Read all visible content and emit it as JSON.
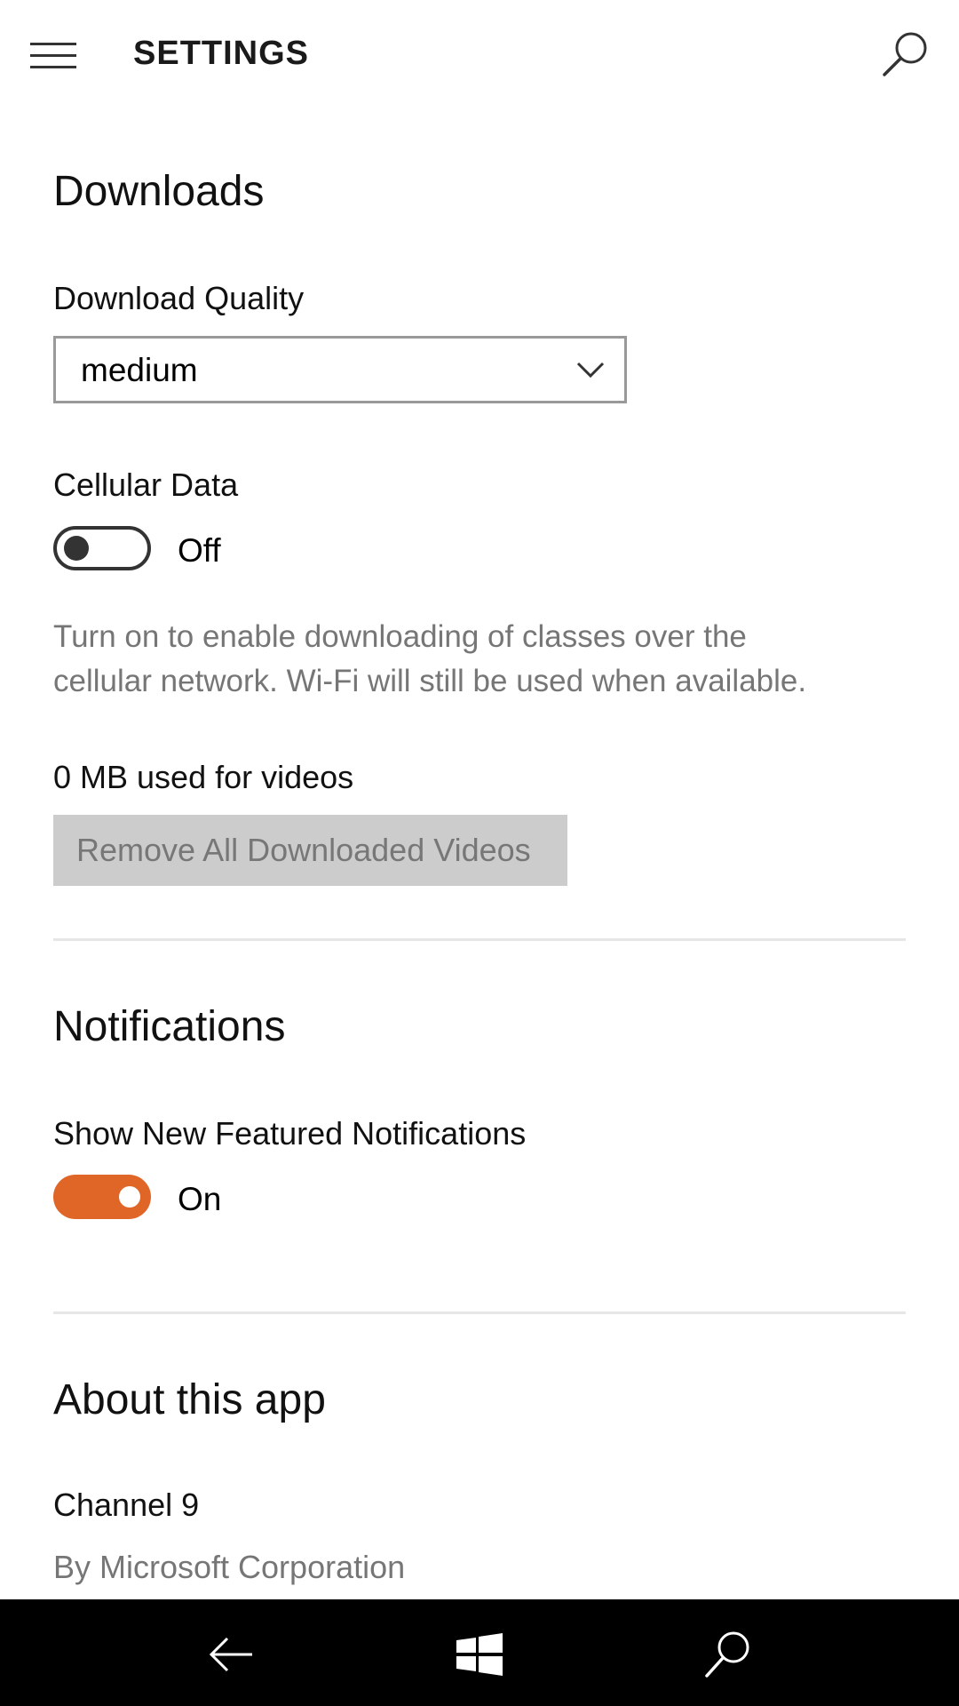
{
  "header": {
    "title": "SETTINGS",
    "menu_icon": "hamburger-menu-icon",
    "search_icon": "search-icon"
  },
  "downloads": {
    "section_title": "Downloads",
    "quality_label": "Download Quality",
    "quality_value": "medium",
    "cellular_label": "Cellular Data",
    "cellular_state": "Off",
    "cellular_description_line1": "Turn on to enable downloading of classes over the",
    "cellular_description_line2": "cellular network. Wi-Fi will still be used when available.",
    "usage_text": "0 MB used for videos",
    "remove_button_label": "Remove All Downloaded Videos"
  },
  "notifications": {
    "section_title": "Notifications",
    "featured_label": "Show New Featured Notifications",
    "featured_state": "On"
  },
  "about": {
    "section_title": "About this app",
    "app_name": "Channel 9",
    "publisher": "By Microsoft Corporation"
  },
  "colors": {
    "accent": "#e06628",
    "nav_bar": "#000000",
    "disabled_button": "#cccccc",
    "muted_text": "#767676"
  },
  "nav_bar": {
    "back_icon": "back-arrow-icon",
    "home_icon": "windows-logo-icon",
    "search_icon": "search-icon"
  }
}
